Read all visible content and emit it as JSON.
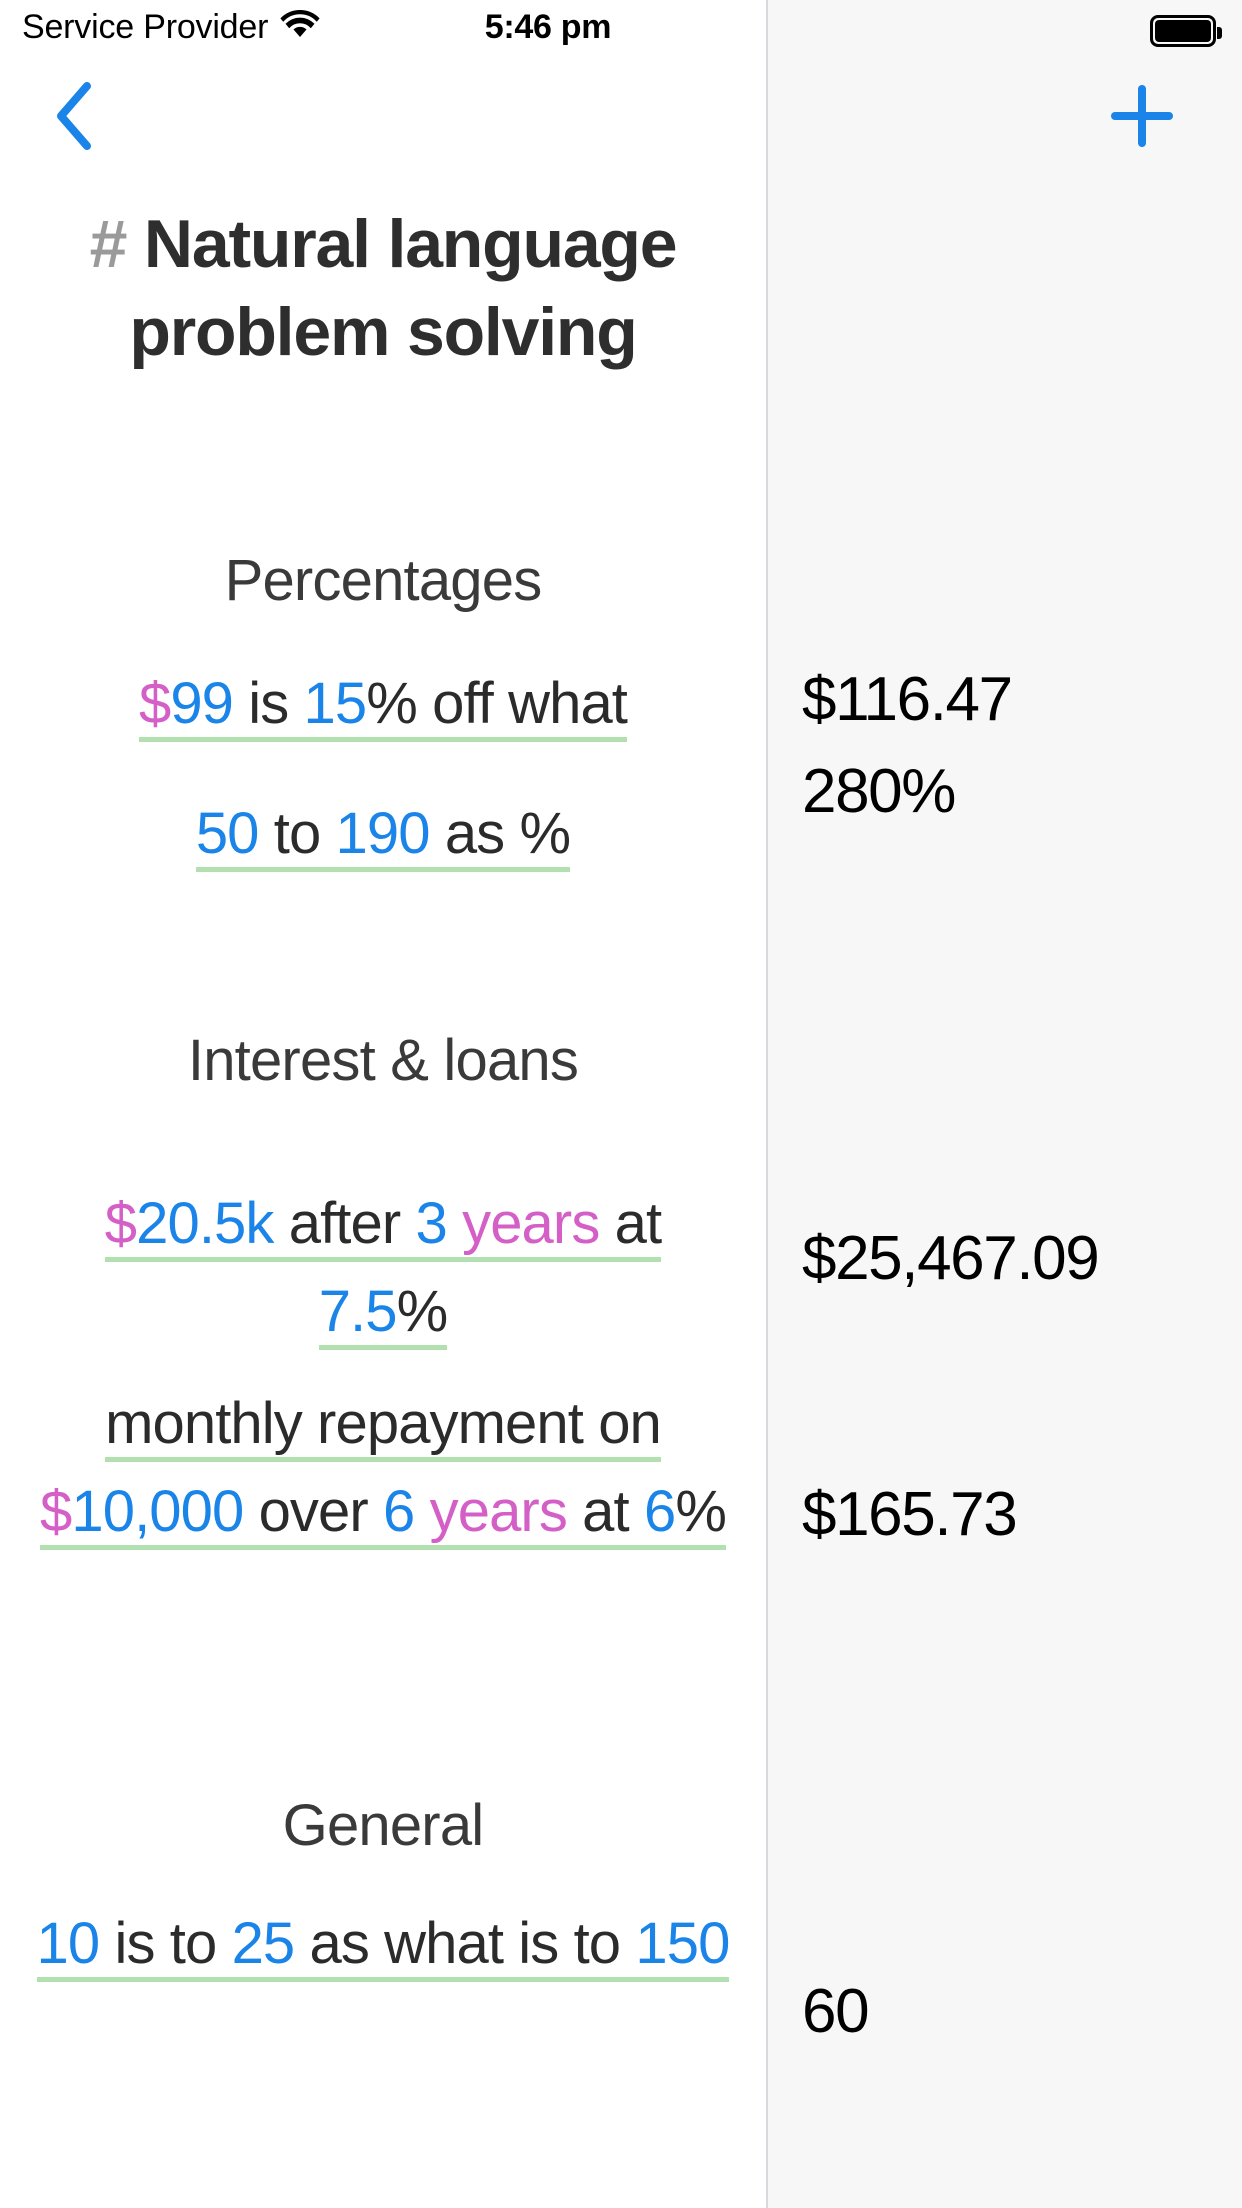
{
  "status_bar": {
    "carrier": "Service Provider",
    "wifi_icon": "wifi-icon",
    "time": "5:46 pm",
    "battery_icon": "battery-full-icon"
  },
  "nav_bar": {
    "back_icon": "chevron-left-icon",
    "add_icon": "plus-icon"
  },
  "page": {
    "hash": "#",
    "title": "Natural language problem solving"
  },
  "colors": {
    "accent_blue": "#1a84e8",
    "number": "#1a84e8",
    "currency_magenta": "#d45fc6",
    "unit_magenta": "#d45fc6",
    "underline_green": "#b3e0b0",
    "text_dark": "#2b2b2b",
    "title_dark": "#2e2e2e",
    "hash_gray": "#9a9a9a",
    "panel_bg": "#f7f7f8",
    "divider": "#d8d8dd"
  },
  "sections": [
    {
      "title": "Percentages",
      "rows": [
        {
          "tokens": [
            {
              "text": "$",
              "kind": "cur"
            },
            {
              "text": "99",
              "kind": "num"
            },
            {
              "text": " is ",
              "kind": "plain"
            },
            {
              "text": "15",
              "kind": "num"
            },
            {
              "text": "% off what",
              "kind": "plain"
            }
          ],
          "plain_text": "$99 is 15% off what",
          "result": "$116.47"
        },
        {
          "tokens": [
            {
              "text": "50",
              "kind": "num"
            },
            {
              "text": " to ",
              "kind": "plain"
            },
            {
              "text": "190",
              "kind": "num"
            },
            {
              "text": " as %",
              "kind": "plain"
            }
          ],
          "plain_text": "50 to 190 as %",
          "result": "280%"
        }
      ]
    },
    {
      "title": "Interest & loans",
      "rows": [
        {
          "tokens": [
            {
              "text": "$",
              "kind": "cur"
            },
            {
              "text": "20.5k",
              "kind": "num"
            },
            {
              "text": " after ",
              "kind": "plain"
            },
            {
              "text": "3",
              "kind": "num"
            },
            {
              "text": " ",
              "kind": "plain"
            },
            {
              "text": "years",
              "kind": "unit"
            },
            {
              "text": " at ",
              "kind": "plain"
            },
            {
              "text": "7.5",
              "kind": "num"
            },
            {
              "text": "%",
              "kind": "plain"
            }
          ],
          "plain_text": "$20.5k after 3 years at 7.5%",
          "result": "$25,467.09"
        },
        {
          "tokens": [
            {
              "text": "monthly repayment on ",
              "kind": "plain"
            },
            {
              "text": "$",
              "kind": "cur"
            },
            {
              "text": "10,000",
              "kind": "num"
            },
            {
              "text": " over ",
              "kind": "plain"
            },
            {
              "text": "6",
              "kind": "num"
            },
            {
              "text": " ",
              "kind": "plain"
            },
            {
              "text": "years",
              "kind": "unit"
            },
            {
              "text": " at ",
              "kind": "plain"
            },
            {
              "text": "6",
              "kind": "num"
            },
            {
              "text": "%",
              "kind": "plain"
            }
          ],
          "plain_text": "monthly repayment on $10,000 over 6 years at 6%",
          "result": "$165.73"
        }
      ]
    },
    {
      "title": "General",
      "rows": [
        {
          "tokens": [
            {
              "text": "10",
              "kind": "num"
            },
            {
              "text": " is to ",
              "kind": "plain"
            },
            {
              "text": "25",
              "kind": "num"
            },
            {
              "text": " as what is to ",
              "kind": "plain"
            },
            {
              "text": "150",
              "kind": "num"
            }
          ],
          "plain_text": "10 is to 25 as what is to 150",
          "result": "60"
        }
      ]
    }
  ],
  "layout": {
    "section_tops": [
      545,
      1025,
      1790
    ],
    "row_tops": [
      [
        660,
        790
      ],
      [
        1180,
        1380
      ],
      [
        1900
      ]
    ],
    "result_tops": [
      [
        663,
        755
      ],
      [
        1222,
        1478
      ],
      [
        1975
      ]
    ]
  }
}
